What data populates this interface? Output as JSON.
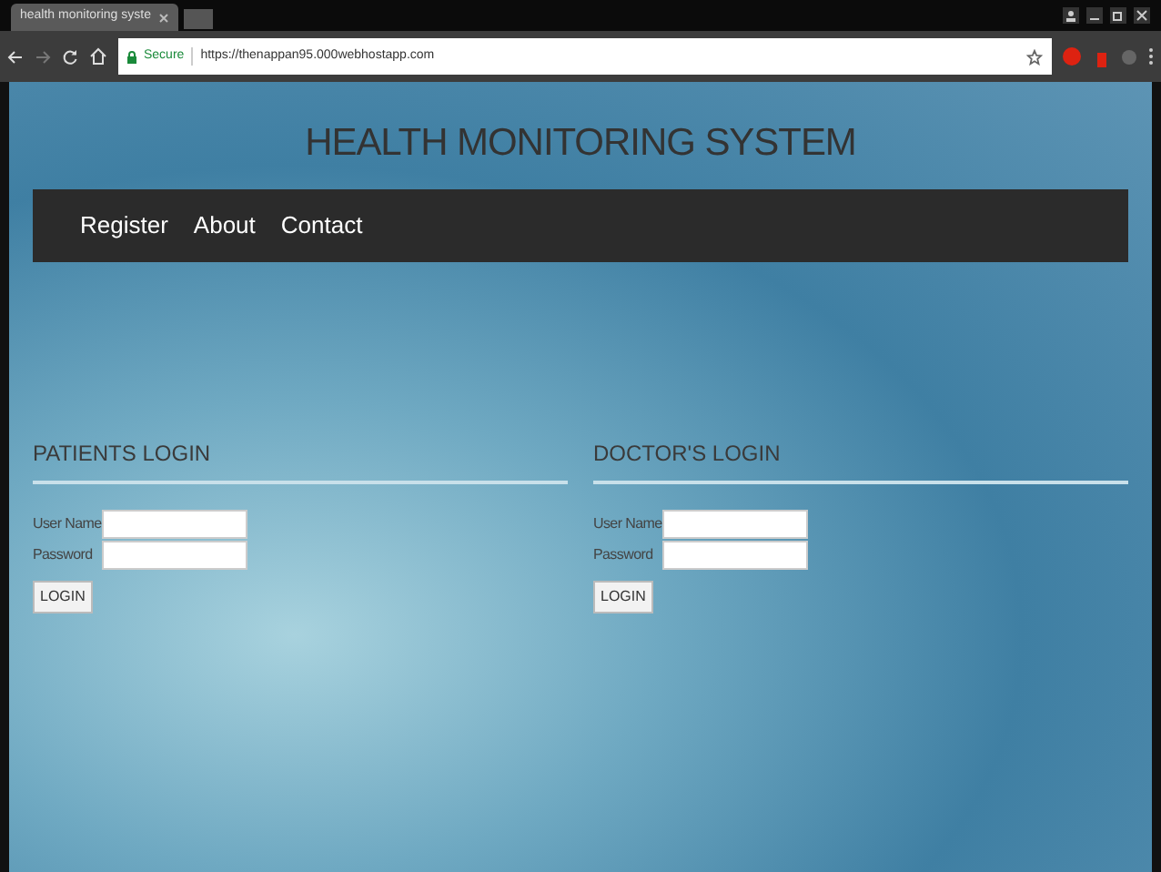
{
  "browser": {
    "tab_title": "health monitoring syste",
    "secure_label": "Secure",
    "url": "https://thenappan95.000webhostapp.com"
  },
  "page": {
    "title": "HEALTH MONITORING SYSTEM",
    "nav": [
      {
        "label": "Register"
      },
      {
        "label": "About"
      },
      {
        "label": "Contact"
      }
    ],
    "panels": [
      {
        "heading": "PATIENTS LOGIN",
        "fields": [
          {
            "label": "User Name"
          },
          {
            "label": "Password"
          }
        ],
        "button": "LOGIN"
      },
      {
        "heading": "DOCTOR'S LOGIN",
        "fields": [
          {
            "label": "User Name"
          },
          {
            "label": "Password"
          }
        ],
        "button": "LOGIN"
      }
    ]
  }
}
